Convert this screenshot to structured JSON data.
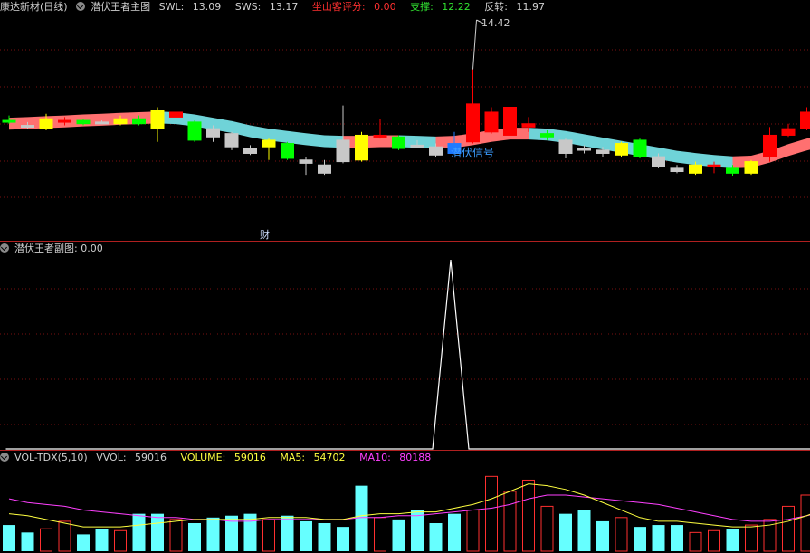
{
  "main": {
    "title": "康达新材(日线)",
    "indicator": "潜伏王者主图",
    "swl_label": "SWL:",
    "swl_value": "13.09",
    "sws_label": "SWS:",
    "sws_value": "13.17",
    "score_label": "坐山客评分:",
    "score_value": "0.00",
    "support_label": "支撑:",
    "support_value": "12.22",
    "reversal_label": "反转:",
    "reversal_value": "11.97",
    "max_price_label": "14.42",
    "signal_label": "潜伏信号",
    "finance_marker": "财",
    "colors": {
      "up": "#ff0000",
      "down": "#00ff00",
      "yellow": "#ffff00",
      "gray": "#c8c8c8",
      "blue": "#1e7bff",
      "band_red": "#ff7070",
      "band_cyan": "#6fd3d8"
    }
  },
  "sub": {
    "title": "潜伏王者副图",
    "value": ": 0.00"
  },
  "vol": {
    "title": "VOL-TDX(5,10)",
    "vvol_label": "VVOL:",
    "vvol_value": "59016",
    "volume_label": "VOLUME:",
    "volume_value": "59016",
    "ma5_label": "MA5:",
    "ma5_value": "54702",
    "ma10_label": "MA10:",
    "ma10_value": "80188",
    "colors": {
      "volume": "#ffff40",
      "ma5": "#ffff40",
      "ma10": "#ff40ff",
      "up": "#ff3030",
      "down": "#66ffff"
    }
  },
  "chart_data": [
    {
      "type": "candlestick",
      "title": "康达新材(日线)",
      "max_marker": 14.42,
      "candles": [
        {
          "o": 11.55,
          "c": 11.55,
          "h": 11.7,
          "l": 11.45,
          "color": "green"
        },
        {
          "o": 11.4,
          "c": 11.4,
          "h": 11.5,
          "l": 11.3,
          "color": "gray"
        },
        {
          "o": 11.3,
          "c": 11.6,
          "h": 11.75,
          "l": 11.25,
          "color": "yellow"
        },
        {
          "o": 11.55,
          "c": 11.55,
          "h": 11.65,
          "l": 11.4,
          "color": "red"
        },
        {
          "o": 11.45,
          "c": 11.55,
          "h": 11.6,
          "l": 11.4,
          "color": "green"
        },
        {
          "o": 11.5,
          "c": 11.5,
          "h": 11.55,
          "l": 11.45,
          "color": "gray"
        },
        {
          "o": 11.45,
          "c": 11.6,
          "h": 11.7,
          "l": 11.4,
          "color": "yellow"
        },
        {
          "o": 11.45,
          "c": 11.6,
          "h": 11.7,
          "l": 11.4,
          "color": "green"
        },
        {
          "o": 11.3,
          "c": 11.85,
          "h": 11.95,
          "l": 10.9,
          "color": "yellow"
        },
        {
          "o": 11.65,
          "c": 11.8,
          "h": 11.85,
          "l": 11.55,
          "color": "red"
        },
        {
          "o": 11.5,
          "c": 10.95,
          "h": 11.55,
          "l": 10.9,
          "color": "green"
        },
        {
          "o": 11.3,
          "c": 11.05,
          "h": 11.4,
          "l": 10.9,
          "color": "gray"
        },
        {
          "o": 11.15,
          "c": 10.75,
          "h": 11.2,
          "l": 10.65,
          "color": "gray"
        },
        {
          "o": 10.7,
          "c": 10.55,
          "h": 10.8,
          "l": 10.5,
          "color": "gray"
        },
        {
          "o": 10.75,
          "c": 10.95,
          "h": 11.0,
          "l": 10.35,
          "color": "yellow"
        },
        {
          "o": 10.85,
          "c": 10.4,
          "h": 10.9,
          "l": 10.35,
          "color": "green"
        },
        {
          "o": 10.35,
          "c": 10.25,
          "h": 10.45,
          "l": 9.9,
          "color": "gray"
        },
        {
          "o": 10.2,
          "c": 9.95,
          "h": 10.35,
          "l": 9.9,
          "color": "gray"
        },
        {
          "o": 10.3,
          "c": 10.95,
          "h": 12.0,
          "l": 10.25,
          "color": "gray"
        },
        {
          "o": 10.35,
          "c": 11.1,
          "h": 11.2,
          "l": 10.3,
          "color": "yellow"
        },
        {
          "o": 11.1,
          "c": 11.1,
          "h": 11.6,
          "l": 11.0,
          "color": "red"
        },
        {
          "o": 11.05,
          "c": 10.7,
          "h": 11.1,
          "l": 10.65,
          "color": "green"
        },
        {
          "o": 10.8,
          "c": 10.8,
          "h": 10.95,
          "l": 10.7,
          "color": "gray"
        },
        {
          "o": 10.75,
          "c": 10.5,
          "h": 10.85,
          "l": 10.45,
          "color": "gray"
        },
        {
          "o": 10.55,
          "c": 10.85,
          "h": 11.2,
          "l": 10.55,
          "color": "blue"
        },
        {
          "o": 10.9,
          "c": 12.05,
          "h": 13.1,
          "l": 10.85,
          "color": "red"
        },
        {
          "o": 11.2,
          "c": 11.8,
          "h": 11.95,
          "l": 11.15,
          "color": "red"
        },
        {
          "o": 11.1,
          "c": 11.95,
          "h": 12.05,
          "l": 11.0,
          "color": "red"
        },
        {
          "o": 11.35,
          "c": 11.45,
          "h": 11.65,
          "l": 11.2,
          "color": "red"
        },
        {
          "o": 11.15,
          "c": 11.05,
          "h": 11.25,
          "l": 10.95,
          "color": "green"
        },
        {
          "o": 10.95,
          "c": 10.55,
          "h": 11.0,
          "l": 10.4,
          "color": "gray"
        },
        {
          "o": 10.7,
          "c": 10.7,
          "h": 10.8,
          "l": 10.55,
          "color": "gray"
        },
        {
          "o": 10.65,
          "c": 10.55,
          "h": 10.75,
          "l": 10.45,
          "color": "gray"
        },
        {
          "o": 10.5,
          "c": 10.85,
          "h": 10.9,
          "l": 10.45,
          "color": "yellow"
        },
        {
          "o": 10.45,
          "c": 10.95,
          "h": 11.0,
          "l": 10.4,
          "color": "green"
        },
        {
          "o": 10.45,
          "c": 10.15,
          "h": 10.55,
          "l": 10.1,
          "color": "gray"
        },
        {
          "o": 10.1,
          "c": 10.0,
          "h": 10.2,
          "l": 9.95,
          "color": "gray"
        },
        {
          "o": 9.95,
          "c": 10.2,
          "h": 10.3,
          "l": 9.9,
          "color": "yellow"
        },
        {
          "o": 10.15,
          "c": 10.2,
          "h": 10.3,
          "l": 9.95,
          "color": "red"
        },
        {
          "o": 10.1,
          "c": 9.95,
          "h": 10.2,
          "l": 9.85,
          "color": "green"
        },
        {
          "o": 9.95,
          "c": 10.3,
          "h": 10.35,
          "l": 9.9,
          "color": "yellow"
        },
        {
          "o": 10.45,
          "c": 11.1,
          "h": 11.35,
          "l": 10.3,
          "color": "red"
        },
        {
          "o": 11.1,
          "c": 11.3,
          "h": 11.45,
          "l": 11.05,
          "color": "red"
        },
        {
          "o": 11.3,
          "c": 11.8,
          "h": 11.95,
          "l": 11.25,
          "color": "red"
        },
        {
          "o": 11.7,
          "c": 12.05,
          "h": 12.3,
          "l": 11.65,
          "color": "red"
        }
      ]
    },
    {
      "type": "line",
      "title": "潜伏王者副图",
      "values": [
        0,
        0,
        0,
        0,
        0,
        0,
        0,
        0,
        0,
        0,
        0,
        0,
        0,
        0,
        0,
        0,
        0,
        0,
        0,
        0,
        0,
        0,
        0,
        0,
        1,
        0,
        0,
        0,
        0,
        0,
        0,
        0,
        0,
        0,
        0,
        0,
        0,
        0,
        0,
        0,
        0,
        0,
        0,
        0,
        0
      ]
    },
    {
      "type": "bar",
      "title": "VOL-TDX(5,10)",
      "volumes": [
        14,
        10,
        12,
        16,
        9,
        12,
        11,
        20,
        20,
        17,
        15,
        18,
        19,
        20,
        17,
        19,
        16,
        15,
        13,
        35,
        18,
        17,
        22,
        15,
        20,
        22,
        40,
        32,
        38,
        24,
        20,
        22,
        16,
        18,
        13,
        14,
        14,
        10,
        11,
        12,
        14,
        17,
        24,
        30,
        38
      ],
      "up": [
        false,
        false,
        true,
        true,
        false,
        false,
        true,
        false,
        false,
        true,
        false,
        false,
        false,
        false,
        true,
        false,
        false,
        false,
        false,
        false,
        true,
        false,
        false,
        false,
        false,
        true,
        true,
        true,
        true,
        true,
        false,
        false,
        false,
        true,
        false,
        false,
        false,
        true,
        true,
        false,
        true,
        true,
        true,
        true,
        true
      ],
      "ma5": [
        20,
        19,
        17,
        15,
        13,
        13,
        13,
        14,
        15,
        16,
        17,
        17,
        17,
        17,
        18,
        18,
        18,
        17,
        17,
        19,
        20,
        20,
        21,
        21,
        23,
        25,
        28,
        32,
        36,
        35,
        33,
        30,
        26,
        22,
        18,
        16,
        16,
        15,
        14,
        13,
        13,
        14,
        16,
        19,
        23
      ],
      "ma10": [
        28,
        26,
        25,
        24,
        22,
        21,
        20,
        19,
        18,
        18,
        17,
        17,
        16,
        16,
        17,
        17,
        17,
        17,
        17,
        18,
        18,
        19,
        19,
        20,
        21,
        22,
        23,
        25,
        28,
        30,
        30,
        29,
        28,
        27,
        26,
        25,
        23,
        21,
        19,
        17,
        16,
        16,
        17,
        19,
        21
      ]
    }
  ]
}
